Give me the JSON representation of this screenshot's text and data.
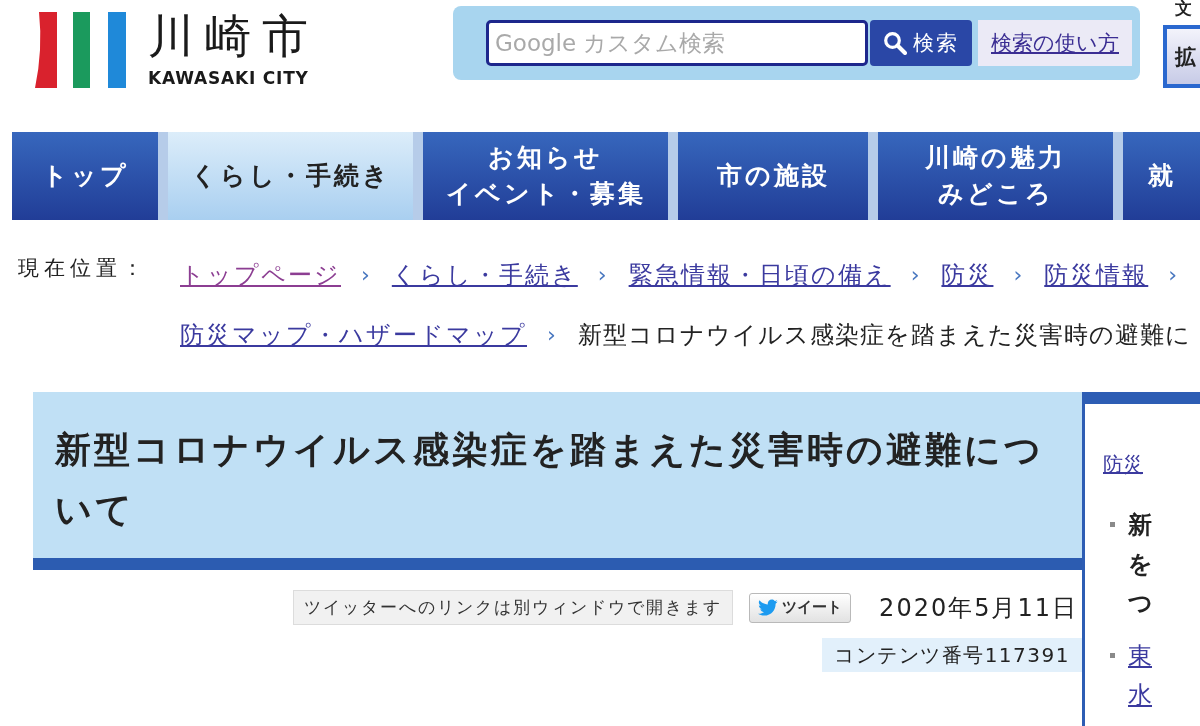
{
  "header": {
    "logo": {
      "name": "川崎市",
      "name_en": "KAWASAKI CITY"
    },
    "search": {
      "placeholder": "Google カスタム検索",
      "button": "検索",
      "help_link": "検索の使い方"
    },
    "text_size": {
      "label": "文",
      "button": "拡"
    }
  },
  "nav": [
    {
      "lines": [
        "トップ"
      ],
      "selected": false
    },
    {
      "lines": [
        "くらし・手続き"
      ],
      "selected": true
    },
    {
      "lines": [
        "お知らせ",
        "イベント・募集"
      ],
      "selected": false
    },
    {
      "lines": [
        "市の施設"
      ],
      "selected": false
    },
    {
      "lines": [
        "川崎の魅力",
        "みどころ"
      ],
      "selected": false
    },
    {
      "lines": [
        "就"
      ],
      "selected": false
    }
  ],
  "breadcrumb": {
    "label": "現在位置：",
    "items": [
      {
        "kind": "link",
        "text": "トップページ",
        "visited": true,
        "separator": "›"
      },
      {
        "kind": "link",
        "text": "くらし・手続き",
        "visited": false,
        "separator": "›"
      },
      {
        "kind": "link",
        "text": "緊急情報・日頃の備え",
        "visited": false,
        "separator": "›"
      },
      {
        "kind": "link",
        "text": "防災",
        "visited": false,
        "separator": "›"
      },
      {
        "kind": "link",
        "text": "防災情報",
        "visited": false,
        "separator": "›"
      },
      {
        "kind": "link",
        "text": "防災マップ・ハザードマップ",
        "visited": false,
        "separator": "›"
      },
      {
        "kind": "current",
        "text": "新型コロナウイルス感染症を踏まえた災害時の避難に"
      }
    ]
  },
  "page": {
    "title": "新型コロナウイルス感染症を踏まえた災害時の避難について",
    "share_notice": "ツイッターへのリンクは別ウィンドウで開きます",
    "tweet_button": "ツイート",
    "date": "2020年5月11日",
    "content_number": "コンテンツ番号117391"
  },
  "sidebar": {
    "heading_link": "防災",
    "items": [
      {
        "kind": "text",
        "lines": [
          "新",
          "を",
          "つ"
        ]
      },
      {
        "kind": "link",
        "lines": [
          "東",
          "水"
        ]
      }
    ]
  }
}
